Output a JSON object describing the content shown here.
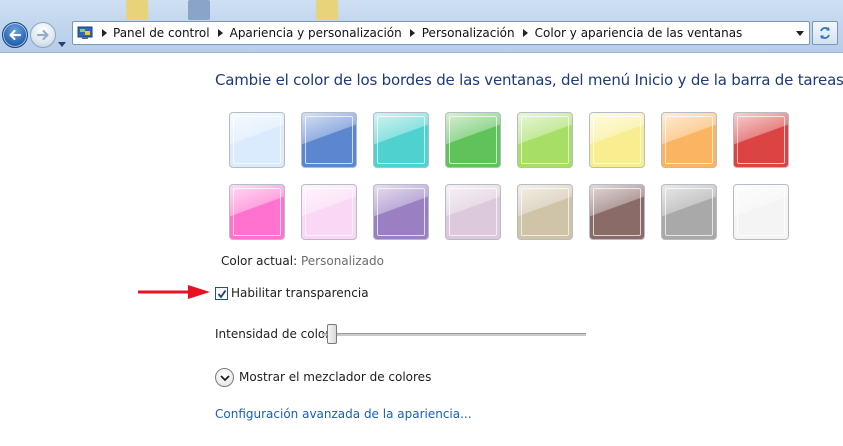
{
  "breadcrumb": {
    "items": [
      "Panel de control",
      "Apariencia y personalización",
      "Personalización",
      "Color y apariencia de las ventanas"
    ]
  },
  "heading": "Cambie el color de los bordes de las ventanas, del menú Inicio y de la barra de tareas",
  "swatches": [
    {
      "color": "#d9ebfc"
    },
    {
      "color": "#5d86d0"
    },
    {
      "color": "#4fd2cf"
    },
    {
      "color": "#5fc25a"
    },
    {
      "color": "#a6de66"
    },
    {
      "color": "#f9ee8f"
    },
    {
      "color": "#fbb562"
    },
    {
      "color": "#dc4444"
    },
    {
      "color": "#ff73cf"
    },
    {
      "color": "#fad7f4"
    },
    {
      "color": "#9a80c2"
    },
    {
      "color": "#dcc9dc"
    },
    {
      "color": "#cfc3a8"
    },
    {
      "color": "#8a6b68"
    },
    {
      "color": "#a9a9a9"
    },
    {
      "color": "#f4f4f4"
    }
  ],
  "current_color": {
    "label": "Color actual:",
    "value": "Personalizado"
  },
  "transparency": {
    "label": "Habilitar transparencia",
    "checked": true
  },
  "intensity": {
    "label": "Intensidad de color:",
    "level": 0.02
  },
  "mixer": {
    "label": "Mostrar el mezclador de colores"
  },
  "advanced_link": "Configuración avanzada de la apariencia...",
  "accents": {
    "heading": "#1e3a78",
    "link": "#1a5fb4",
    "arrow": "#e81123"
  },
  "icons": [
    "back-arrow-icon",
    "forward-arrow-icon",
    "dropdown-icon",
    "control-panel-icon",
    "breadcrumb-separator-icon",
    "refresh-icon",
    "checkmark-icon",
    "chevron-down-icon",
    "red-arrow-icon"
  ]
}
